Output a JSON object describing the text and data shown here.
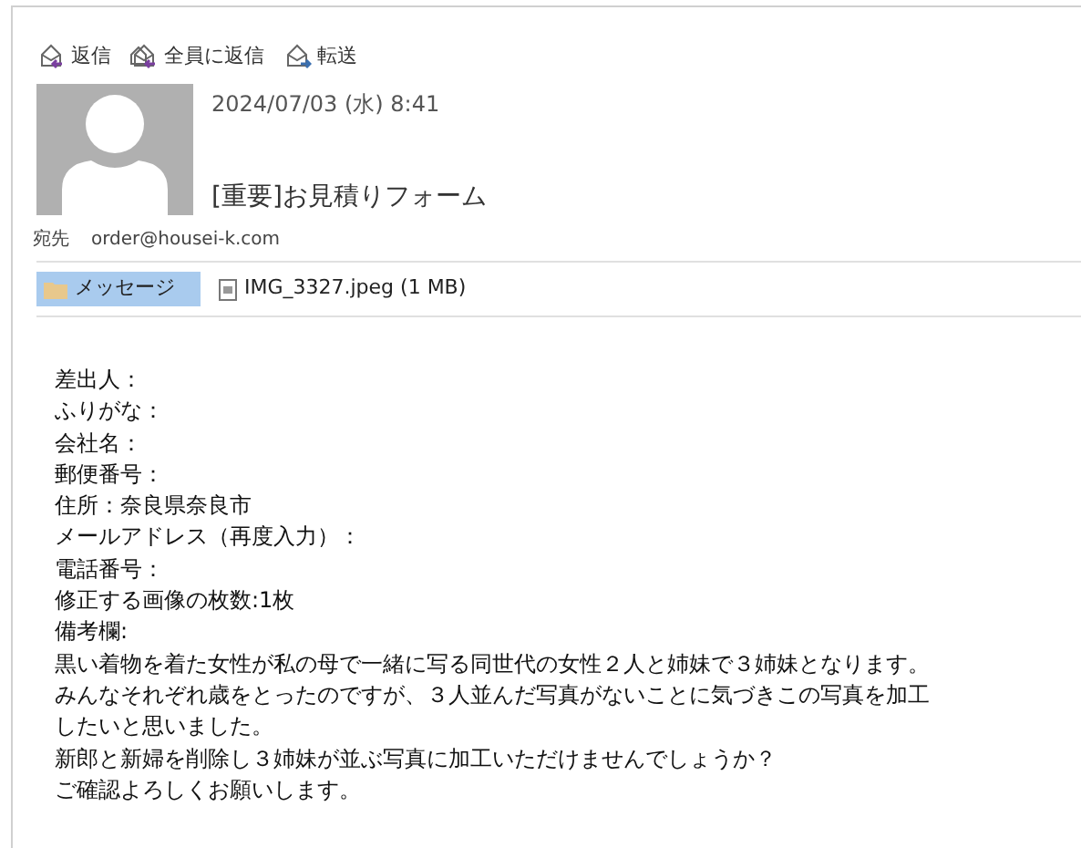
{
  "toolbar": [
    {
      "kind": "reply",
      "label": "返信"
    },
    {
      "kind": "reply_all",
      "label": "全員に返信"
    },
    {
      "kind": "forward",
      "label": "転送"
    }
  ],
  "message": {
    "date": "2024/07/03 (水) 8:41",
    "subject": "[重要]お見積りフォーム",
    "to_label": "宛先",
    "to": "order@housei-k.com"
  },
  "attachments": [
    {
      "kind": "message",
      "label": "メッセージ",
      "selected": true
    },
    {
      "kind": "file",
      "label": "IMG_3327.jpeg (1 MB)",
      "selected": false
    }
  ],
  "body": [
    "差出人：",
    "ふりがな：",
    "会社名：",
    "郵便番号：",
    "住所：奈良県奈良市",
    "メールアドレス（再度入力）：",
    "電話番号：",
    "修正する画像の枚数:1枚",
    "備考欄:",
    "黒い着物を着た女性が私の母で一緒に写る同世代の女性２人と姉妹で３姉妹となります。",
    "みんなそれぞれ歳をとったのですが、３人並んだ写真がないことに気づきこの写真を加工",
    "したいと思いました。",
    "新郎と新婦を削除し３姉妹が並ぶ写真に加工いただけませんでしょうか？",
    "ご確認よろしくお願いします。"
  ]
}
